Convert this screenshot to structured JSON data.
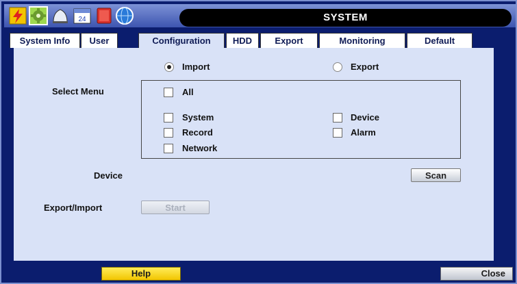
{
  "window": {
    "title": "SYSTEM"
  },
  "toolbar_icons": [
    "lightning-icon",
    "gear-icon",
    "bell-icon",
    "calendar-icon",
    "book-icon",
    "globe-icon"
  ],
  "calendar_day": "24",
  "tabs": [
    {
      "label": "System Info",
      "active": false
    },
    {
      "label": "User",
      "active": false
    },
    {
      "label": "Configuration",
      "active": true
    },
    {
      "label": "HDD",
      "active": false
    },
    {
      "label": "Export",
      "active": false
    },
    {
      "label": "Monitoring",
      "active": false
    },
    {
      "label": "Default",
      "active": false
    }
  ],
  "mode": {
    "import_label": "Import",
    "export_label": "Export",
    "selected": "Import"
  },
  "select_menu": {
    "label": "Select Menu",
    "options": {
      "all": "All",
      "system": "System",
      "device": "Device",
      "record": "Record",
      "alarm": "Alarm",
      "network": "Network"
    }
  },
  "device": {
    "label": "Device",
    "scan_button": "Scan"
  },
  "export_import": {
    "label": "Export/Import",
    "start_button": "Start"
  },
  "footer": {
    "help_button": "Help",
    "close_button": "Close"
  },
  "colors": {
    "background": "#0b1d6e",
    "panel": "#d9e2f7",
    "help": "#f2c500"
  }
}
